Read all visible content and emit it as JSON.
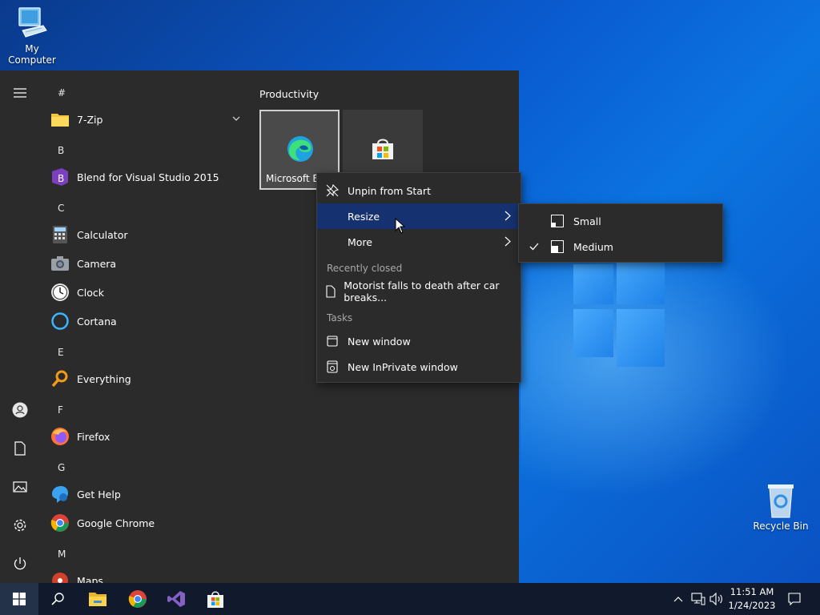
{
  "desktop": {
    "icons": [
      {
        "label": "My Computer",
        "icon": "computer-icon"
      },
      {
        "label": "Recycle Bin",
        "icon": "recycle-bin-icon"
      }
    ]
  },
  "start_menu": {
    "rail_icons": [
      "hamburger-icon",
      "user-icon",
      "documents-icon",
      "pictures-icon",
      "settings-icon",
      "power-icon"
    ],
    "app_list": {
      "letters": [
        "#",
        "B",
        "C",
        "E",
        "F",
        "G",
        "M"
      ],
      "apps": [
        "7-Zip",
        "Blend for Visual Studio 2015",
        "Calculator",
        "Camera",
        "Clock",
        "Cortana",
        "Everything",
        "Firefox",
        "Get Help",
        "Google Chrome",
        "Maps"
      ]
    },
    "tiles": {
      "group_title": "Productivity",
      "edge_label": "Microsoft E"
    }
  },
  "context_menu": {
    "items": [
      "Unpin from Start",
      "Resize",
      "More"
    ],
    "recently_closed_header": "Recently closed",
    "recent_item": "Motorist falls to death after car breaks...",
    "tasks_header": "Tasks",
    "tasks": [
      "New window",
      "New InPrivate window"
    ]
  },
  "resize_submenu": {
    "items": [
      "Small",
      "Medium"
    ],
    "checked": "Medium"
  },
  "taskbar": {
    "time": "11:51 AM",
    "date": "1/24/2023"
  },
  "colors": {
    "highlight": "#16316f",
    "menu_bg": "#2b2b2b",
    "taskbar_bg": "#101a2c"
  }
}
